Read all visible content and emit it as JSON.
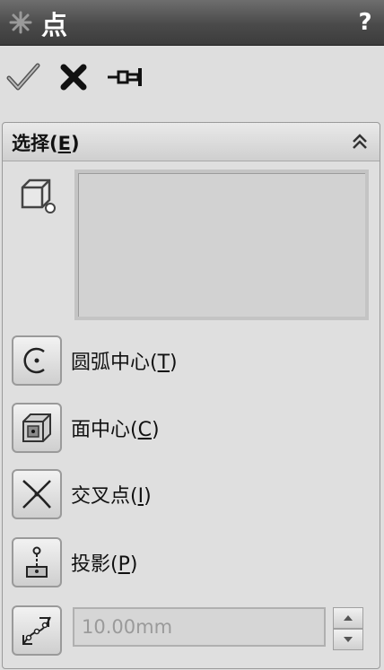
{
  "titlebar": {
    "title": "点",
    "help_label": "?"
  },
  "actions": {
    "ok_icon": "checkmark-icon",
    "cancel_icon": "x-icon",
    "pin_icon": "pushpin-icon"
  },
  "selection": {
    "header": "选择(",
    "header_mnemonic": "E",
    "header_close": ")",
    "options": [
      {
        "label": "圆弧中心(",
        "mnemonic": "T",
        "close": ")",
        "icon": "arc-center-icon"
      },
      {
        "label": "面中心(",
        "mnemonic": "C",
        "close": ")",
        "icon": "face-center-icon"
      },
      {
        "label": "交叉点(",
        "mnemonic": "I",
        "close": ")",
        "icon": "intersection-icon"
      },
      {
        "label": "投影(",
        "mnemonic": "P",
        "close": ")",
        "icon": "projection-icon"
      }
    ],
    "distance_value": "10.00mm"
  },
  "colors": {
    "titlebar": "#4a4a4a",
    "panel": "#dfdfdf",
    "text": "#111111"
  }
}
